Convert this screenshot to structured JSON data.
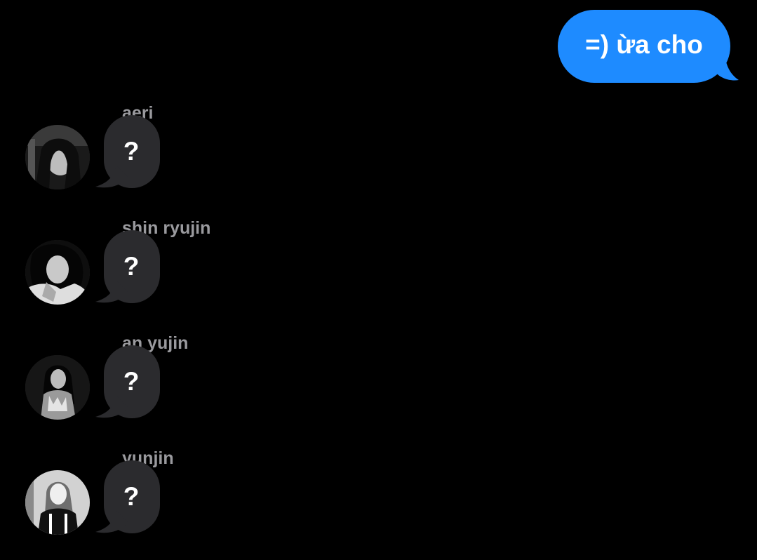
{
  "colors": {
    "background": "#000000",
    "outgoing_bubble": "#1e8bff",
    "incoming_bubble": "#2b2b2e",
    "sender_name": "#9a9a9e",
    "bubble_text": "#ffffff"
  },
  "outgoing": {
    "text": "=) ừa cho"
  },
  "messages": [
    {
      "sender": "aeri",
      "text": "?",
      "avatar": "avatar-photo"
    },
    {
      "sender": "shin ryujin",
      "text": "?",
      "avatar": "avatar-photo"
    },
    {
      "sender": "an yujin",
      "text": "?",
      "avatar": "avatar-photo"
    },
    {
      "sender": "yunjin",
      "text": "?",
      "avatar": "avatar-photo"
    }
  ]
}
